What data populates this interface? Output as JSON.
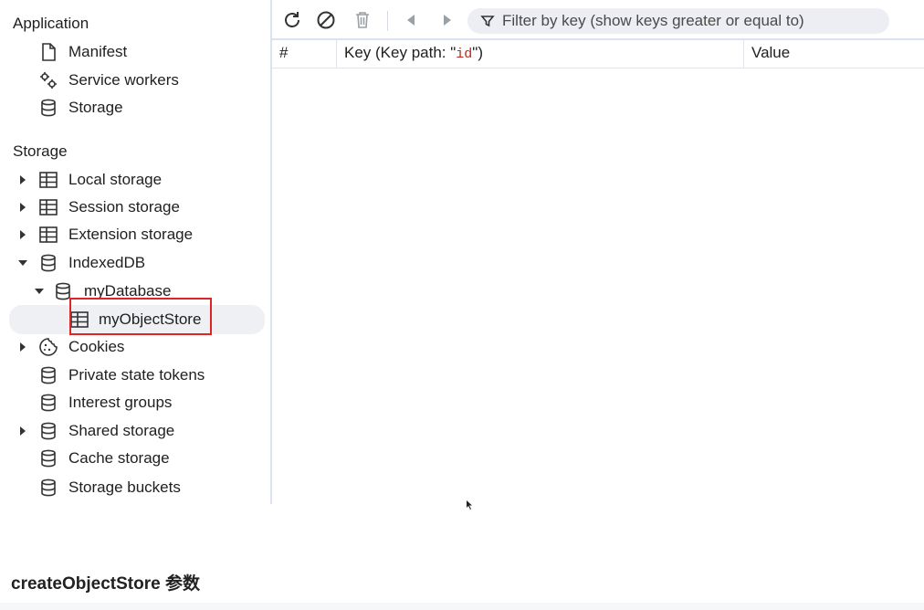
{
  "sidebar": {
    "application_header": "Application",
    "application_items": [
      {
        "label": "Manifest",
        "icon": "document-icon"
      },
      {
        "label": "Service workers",
        "icon": "gears-icon"
      },
      {
        "label": "Storage",
        "icon": "database-icon"
      }
    ],
    "storage_header": "Storage",
    "storage_items": [
      {
        "label": "Local storage",
        "icon": "table-icon",
        "expandable": true,
        "expanded": false
      },
      {
        "label": "Session storage",
        "icon": "table-icon",
        "expandable": true,
        "expanded": false
      },
      {
        "label": "Extension storage",
        "icon": "table-icon",
        "expandable": true,
        "expanded": false
      },
      {
        "label": "IndexedDB",
        "icon": "database-icon",
        "expandable": true,
        "expanded": true
      },
      {
        "label": "myDatabase",
        "icon": "database-icon",
        "expandable": true,
        "expanded": true
      },
      {
        "label": "myObjectStore",
        "icon": "table-icon",
        "selected": true
      },
      {
        "label": "Cookies",
        "icon": "cookie-icon",
        "expandable": true,
        "expanded": false
      },
      {
        "label": "Private state tokens",
        "icon": "database-icon"
      },
      {
        "label": "Interest groups",
        "icon": "database-icon"
      },
      {
        "label": "Shared storage",
        "icon": "database-icon",
        "expandable": true,
        "expanded": false
      },
      {
        "label": "Cache storage",
        "icon": "database-icon"
      },
      {
        "label": "Storage buckets",
        "icon": "database-icon"
      }
    ]
  },
  "toolbar": {
    "filter_placeholder": "Filter by key (show keys greater or equal to)",
    "buttons": [
      "refresh-icon",
      "clear-icon",
      "delete-icon",
      "previous-page-icon",
      "next-page-icon"
    ]
  },
  "table": {
    "col_index": "#",
    "col_key_prefix": "Key (Key path: \"",
    "col_key_path": "id",
    "col_key_suffix": "\")",
    "col_value": "Value"
  },
  "caption": "createObjectStore 参数",
  "colors": {
    "highlight_border": "#e02424",
    "selected_bg": "#eef0f4",
    "divider": "#dbe3f3",
    "key_path_text": "#b5281f"
  }
}
